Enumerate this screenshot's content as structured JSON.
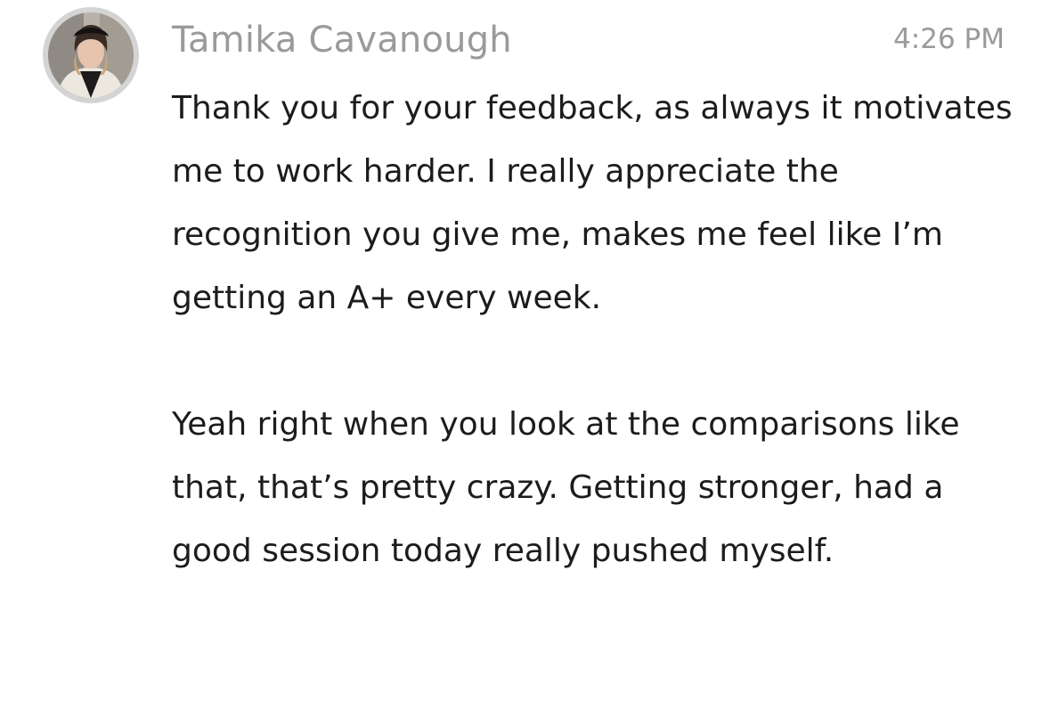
{
  "message": {
    "sender_name": "Tamika Cavanough",
    "timestamp": "4:26 PM",
    "avatar": "user-avatar-photo",
    "paragraphs": [
      "Thank you for your feedback, as always it motivates me to work harder. I really appreciate the recognition you give me, makes me feel like I’m getting an A+ every week.",
      "Yeah right when you look at the comparisons like that, that’s pretty crazy. Getting stronger, had a good session today really pushed myself."
    ]
  },
  "colors": {
    "meta_text": "#9a9a9a",
    "body_text": "#1c1c1c",
    "avatar_ring": "#d4d4d4",
    "background": "#ffffff"
  }
}
